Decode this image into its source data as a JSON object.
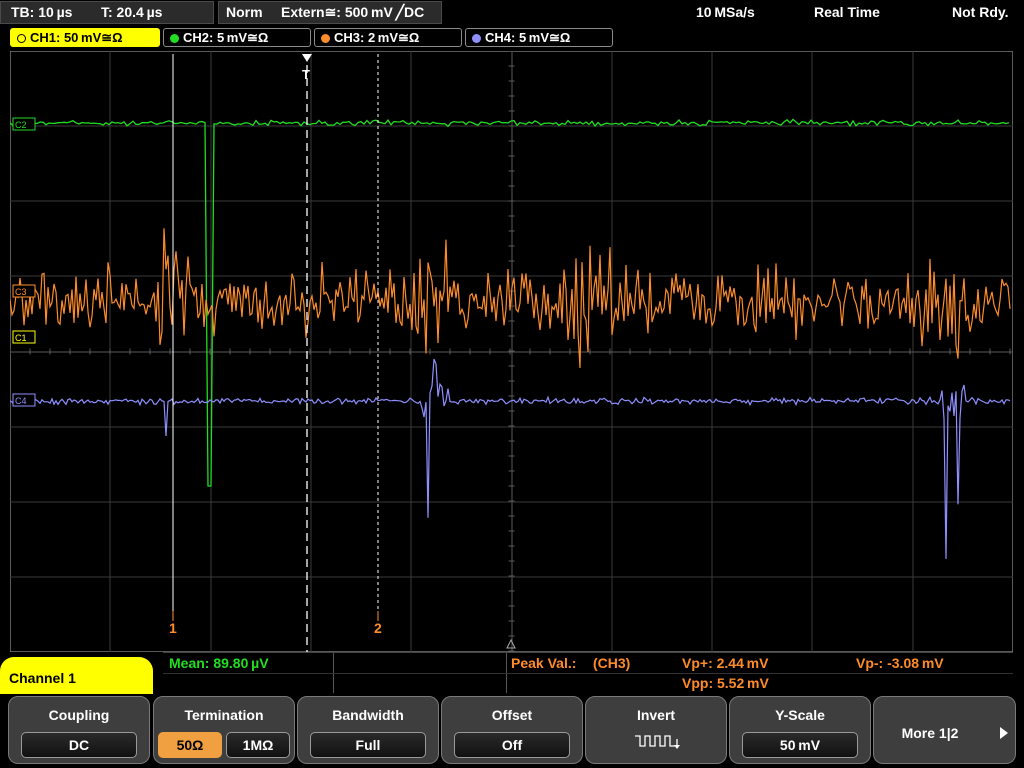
{
  "topbar": {
    "timebase": "TB: 10 µs",
    "trigger_pos": "T: 20.4 µs",
    "mode": "Norm",
    "trigger_source": "Extern≅: 500 mV ╱DC",
    "sample_rate": "10 MSa/s",
    "acq_mode": "Real Time",
    "status": "Not Rdy."
  },
  "channels": [
    {
      "label": "CH1: 50 mV≅Ω",
      "color": "#ffff00",
      "active": true
    },
    {
      "label": "CH2: 5 mV≅Ω",
      "color": "#22dd22",
      "active": false
    },
    {
      "label": "CH3: 2 mV≅Ω",
      "color": "#ff8c2a",
      "active": false
    },
    {
      "label": "CH4: 5 mV≅Ω",
      "color": "#8f8fff",
      "active": false
    }
  ],
  "screen": {
    "trigger_marker": "T",
    "cursor1_label": "1",
    "cursor2_label": "2",
    "markers": {
      "ch1": "C1",
      "ch2": "C2",
      "ch3": "C3",
      "ch4": "C4"
    }
  },
  "measurements": {
    "mean": "Mean: 89.80 µV",
    "peak_label": "Peak Val.:",
    "peak_source": "(CH3)",
    "vp_plus": "Vp+: 2.44 mV",
    "vp_minus": "Vp-: -3.08 mV",
    "vpp": "Vpp: 5.52 mV"
  },
  "menu": {
    "channel_title": "Channel 1",
    "coupling": {
      "title": "Coupling",
      "value": "DC"
    },
    "termination": {
      "title": "Termination",
      "opt1": "50Ω",
      "opt2": "1MΩ"
    },
    "bandwidth": {
      "title": "Bandwidth",
      "value": "Full"
    },
    "offset": {
      "title": "Offset",
      "value": "Off"
    },
    "invert": {
      "title": "Invert"
    },
    "yscale": {
      "title": "Y-Scale",
      "value": "50 mV"
    },
    "more": {
      "label": "More 1|2"
    }
  }
}
